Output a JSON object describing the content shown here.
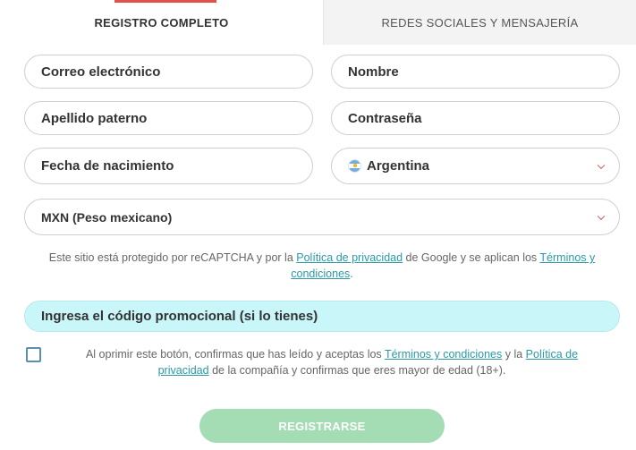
{
  "tabs": {
    "active": "REGISTRO COMPLETO",
    "inactive": "REDES SOCIALES Y MENSAJERÍA"
  },
  "form": {
    "email_placeholder": "Correo electrónico",
    "name_placeholder": "Nombre",
    "surname_placeholder": "Apellido paterno",
    "password_placeholder": "Contraseña",
    "birthdate_placeholder": "Fecha de nacimiento",
    "country_value": "Argentina",
    "country_flag_icon": "argentina-flag-icon",
    "currency_value": "MXN (Peso mexicano)",
    "chevron_icon": "chevron-down-icon"
  },
  "recaptcha": {
    "text_before": "Este sitio está protegido por reCAPTCHA y por la ",
    "privacy_link": "Política de privacidad",
    "text_middle": " de Google y se aplican los ",
    "terms_link": "Términos y condiciones",
    "text_after": "."
  },
  "promo": {
    "label": "Ingresa el código promocional (si lo tienes)"
  },
  "agreement": {
    "text_before": "Al oprimir este botón, confirmas que has leído y aceptas los ",
    "terms_link": "Términos y condiciones",
    "text_middle": " y la ",
    "privacy_link": "Política de privacidad",
    "text_after": " de la compañía y confirmas que eres mayor de edad (18+)."
  },
  "submit": {
    "label": "REGISTRARSE"
  },
  "colors": {
    "tab_accent": "#e25048",
    "link": "#2a9aa5",
    "promo_bg": "#c9f6f9",
    "submit_bg": "#a4dcb4"
  }
}
